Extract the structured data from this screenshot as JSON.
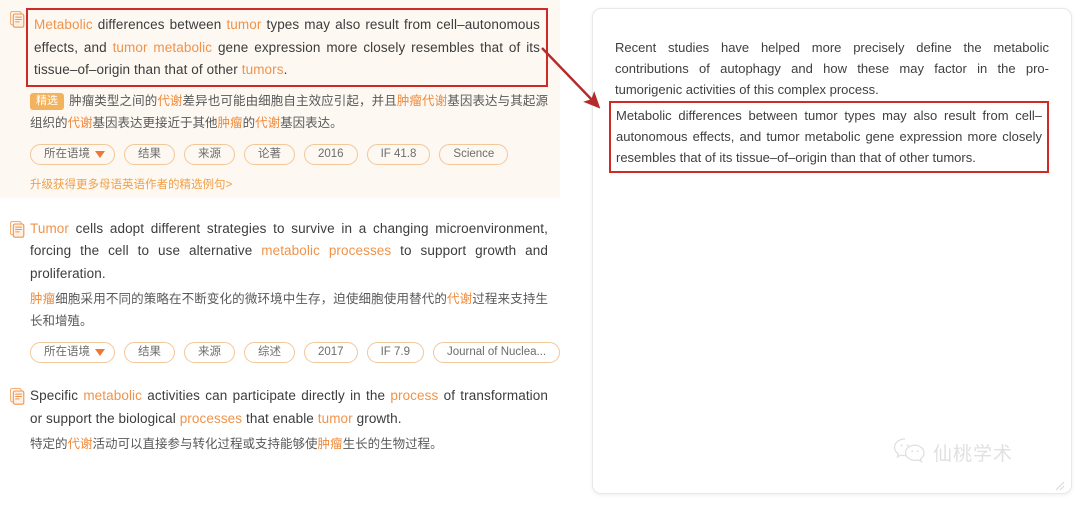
{
  "colors": {
    "keyword": "#f0934a",
    "highlight_box": "#cf2a26",
    "featured_bg": "#fdf8f2",
    "badge_bg": "#f3b35e",
    "tag_border": "#f2c79a",
    "link": "#f0a04a"
  },
  "left_panel": {
    "entries": [
      {
        "featured": true,
        "icon": "document-quote-icon",
        "highlighted": true,
        "en_parts": [
          {
            "t": "Metabolic",
            "kw": true
          },
          {
            "t": " differences between ",
            "kw": false
          },
          {
            "t": "tumor",
            "kw": true
          },
          {
            "t": " types may also result from cell–autonomous effects, and ",
            "kw": false
          },
          {
            "t": "tumor metabolic",
            "kw": true
          },
          {
            "t": " gene expression more closely resembles that of its tissue–of–origin than that of other ",
            "kw": false
          },
          {
            "t": "tumors",
            "kw": true
          },
          {
            "t": ".",
            "kw": false
          }
        ],
        "badge": "精选",
        "zh_parts": [
          {
            "t": "肿瘤类型之间的",
            "kw": false
          },
          {
            "t": "代谢",
            "kw": true
          },
          {
            "t": "差异也可能由细胞自主效应引起，并且",
            "kw": false
          },
          {
            "t": "肿瘤代谢",
            "kw": true
          },
          {
            "t": "基因表达与其起源组织的",
            "kw": false
          },
          {
            "t": "代谢",
            "kw": true
          },
          {
            "t": "基因表达更接近于其他",
            "kw": false
          },
          {
            "t": "肿瘤",
            "kw": true
          },
          {
            "t": "的",
            "kw": false
          },
          {
            "t": "代谢",
            "kw": true
          },
          {
            "t": "基因表达。",
            "kw": false
          }
        ],
        "tags": [
          {
            "label": "所在语境",
            "caret": true
          },
          {
            "label": "结果",
            "caret": false
          },
          {
            "label": "来源",
            "caret": false
          },
          {
            "label": "论著",
            "caret": false
          },
          {
            "label": "2016",
            "caret": false
          },
          {
            "label": "IF 41.8",
            "caret": false
          },
          {
            "label": "Science",
            "caret": false
          }
        ],
        "upgrade_link": "升级获得更多母语英语作者的精选例句>"
      },
      {
        "featured": false,
        "icon": "document-quote-icon",
        "highlighted": false,
        "en_parts": [
          {
            "t": "Tumor",
            "kw": true
          },
          {
            "t": " cells adopt different strategies to survive in a changing microenvironment, forcing the cell to use alternative ",
            "kw": false
          },
          {
            "t": "metabolic processes",
            "kw": true
          },
          {
            "t": " to support growth and proliferation.",
            "kw": false
          }
        ],
        "badge": "",
        "zh_parts": [
          {
            "t": "肿瘤",
            "kw": true
          },
          {
            "t": "细胞采用不同的策略在不断变化的微环境中生存，迫使细胞使用替代的",
            "kw": false
          },
          {
            "t": "代谢",
            "kw": true
          },
          {
            "t": "过程来支持生长和增殖。",
            "kw": false
          }
        ],
        "tags": [
          {
            "label": "所在语境",
            "caret": true
          },
          {
            "label": "结果",
            "caret": false
          },
          {
            "label": "来源",
            "caret": false
          },
          {
            "label": "综述",
            "caret": false
          },
          {
            "label": "2017",
            "caret": false
          },
          {
            "label": "IF 7.9",
            "caret": false
          },
          {
            "label": "Journal of Nuclea...",
            "caret": false
          }
        ],
        "upgrade_link": ""
      },
      {
        "featured": false,
        "icon": "document-quote-icon",
        "highlighted": false,
        "en_parts": [
          {
            "t": "Specific ",
            "kw": false
          },
          {
            "t": "metabolic",
            "kw": true
          },
          {
            "t": " activities can participate directly in the ",
            "kw": false
          },
          {
            "t": "process",
            "kw": true
          },
          {
            "t": " of transformation or support the biological ",
            "kw": false
          },
          {
            "t": "processes",
            "kw": true
          },
          {
            "t": " that enable ",
            "kw": false
          },
          {
            "t": "tumor",
            "kw": true
          },
          {
            "t": " growth.",
            "kw": false
          }
        ],
        "badge": "",
        "zh_parts": [
          {
            "t": "特定的",
            "kw": false
          },
          {
            "t": "代谢",
            "kw": true
          },
          {
            "t": "活动可以直接参与转化过程或支持能够使",
            "kw": false
          },
          {
            "t": "肿瘤",
            "kw": true
          },
          {
            "t": "生长的生物过程。",
            "kw": false
          }
        ],
        "tags": [],
        "upgrade_link": ""
      }
    ]
  },
  "right_panel": {
    "paragraph": "Recent studies have helped more precisely define the metabolic contributions of autophagy and how these may factor in the pro-tumorigenic activities of this complex process.",
    "highlighted_paragraph": "Metabolic differences between tumor types may also result from cell–autonomous effects, and tumor metabolic gene expression more closely resembles that of its tissue–of–origin than that of other tumors.",
    "resize_handle_icon": "resize-grip-icon"
  },
  "annotation": {
    "arrow_icon": "red-arrow-icon"
  },
  "watermark": {
    "logo_icon": "wechat-logo-icon",
    "text": "仙桃学术"
  }
}
